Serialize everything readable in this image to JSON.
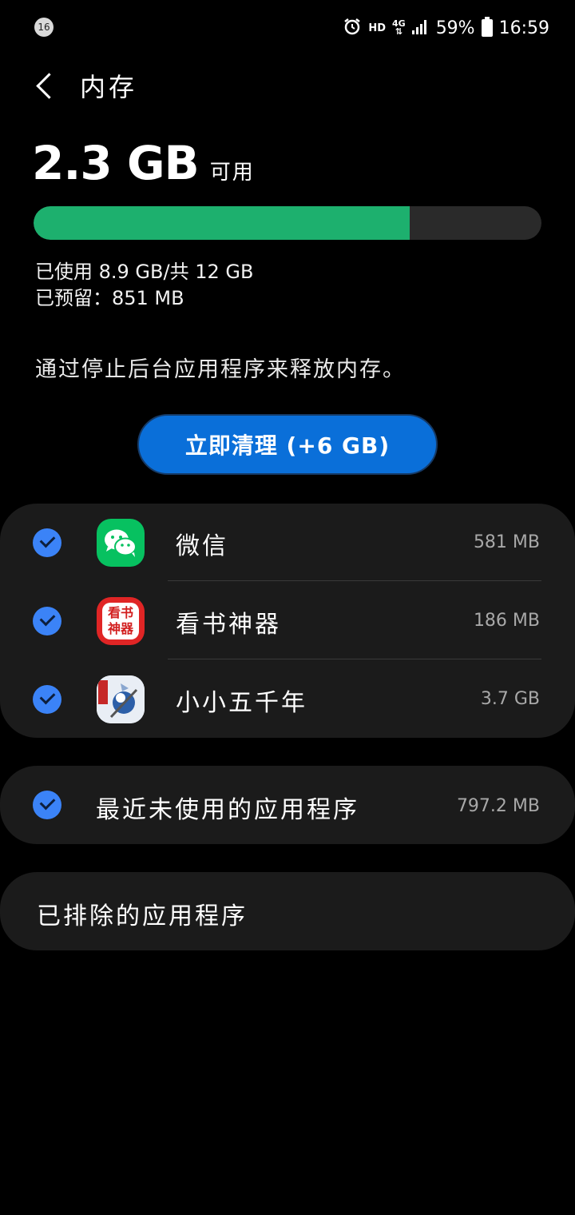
{
  "status_bar": {
    "notification_count": "16",
    "network_hd": "HD",
    "network_type": "4G",
    "battery": "59%",
    "time": "16:59"
  },
  "header": {
    "title": "内存"
  },
  "memory": {
    "available_value": "2.3 GB",
    "available_label": "可用",
    "used_fraction": 0.74,
    "used_text": "已使用 8.9 GB/共 12 GB",
    "reserved_text": "已预留：851 MB"
  },
  "hint": "通过停止后台应用程序来释放内存。",
  "clean_button": "立即清理 (+6 GB)",
  "apps": [
    {
      "name": "微信",
      "size": "581 MB",
      "icon": "wechat-icon"
    },
    {
      "name": "看书神器",
      "size": "186 MB",
      "icon": "kanshu-icon",
      "icon_text": "看书\n神器"
    },
    {
      "name": "小小五千年",
      "size": "3.7 GB",
      "icon": "xiaoxiao-icon"
    }
  ],
  "recent_unused": {
    "label": "最近未使用的应用程序",
    "size": "797.2 MB"
  },
  "excluded": {
    "label": "已排除的应用程序"
  },
  "colors": {
    "usage_green": "#1db06e",
    "button_blue": "#0a6fd9",
    "check_blue": "#3b83f7",
    "card_bg": "#1b1b1b"
  }
}
